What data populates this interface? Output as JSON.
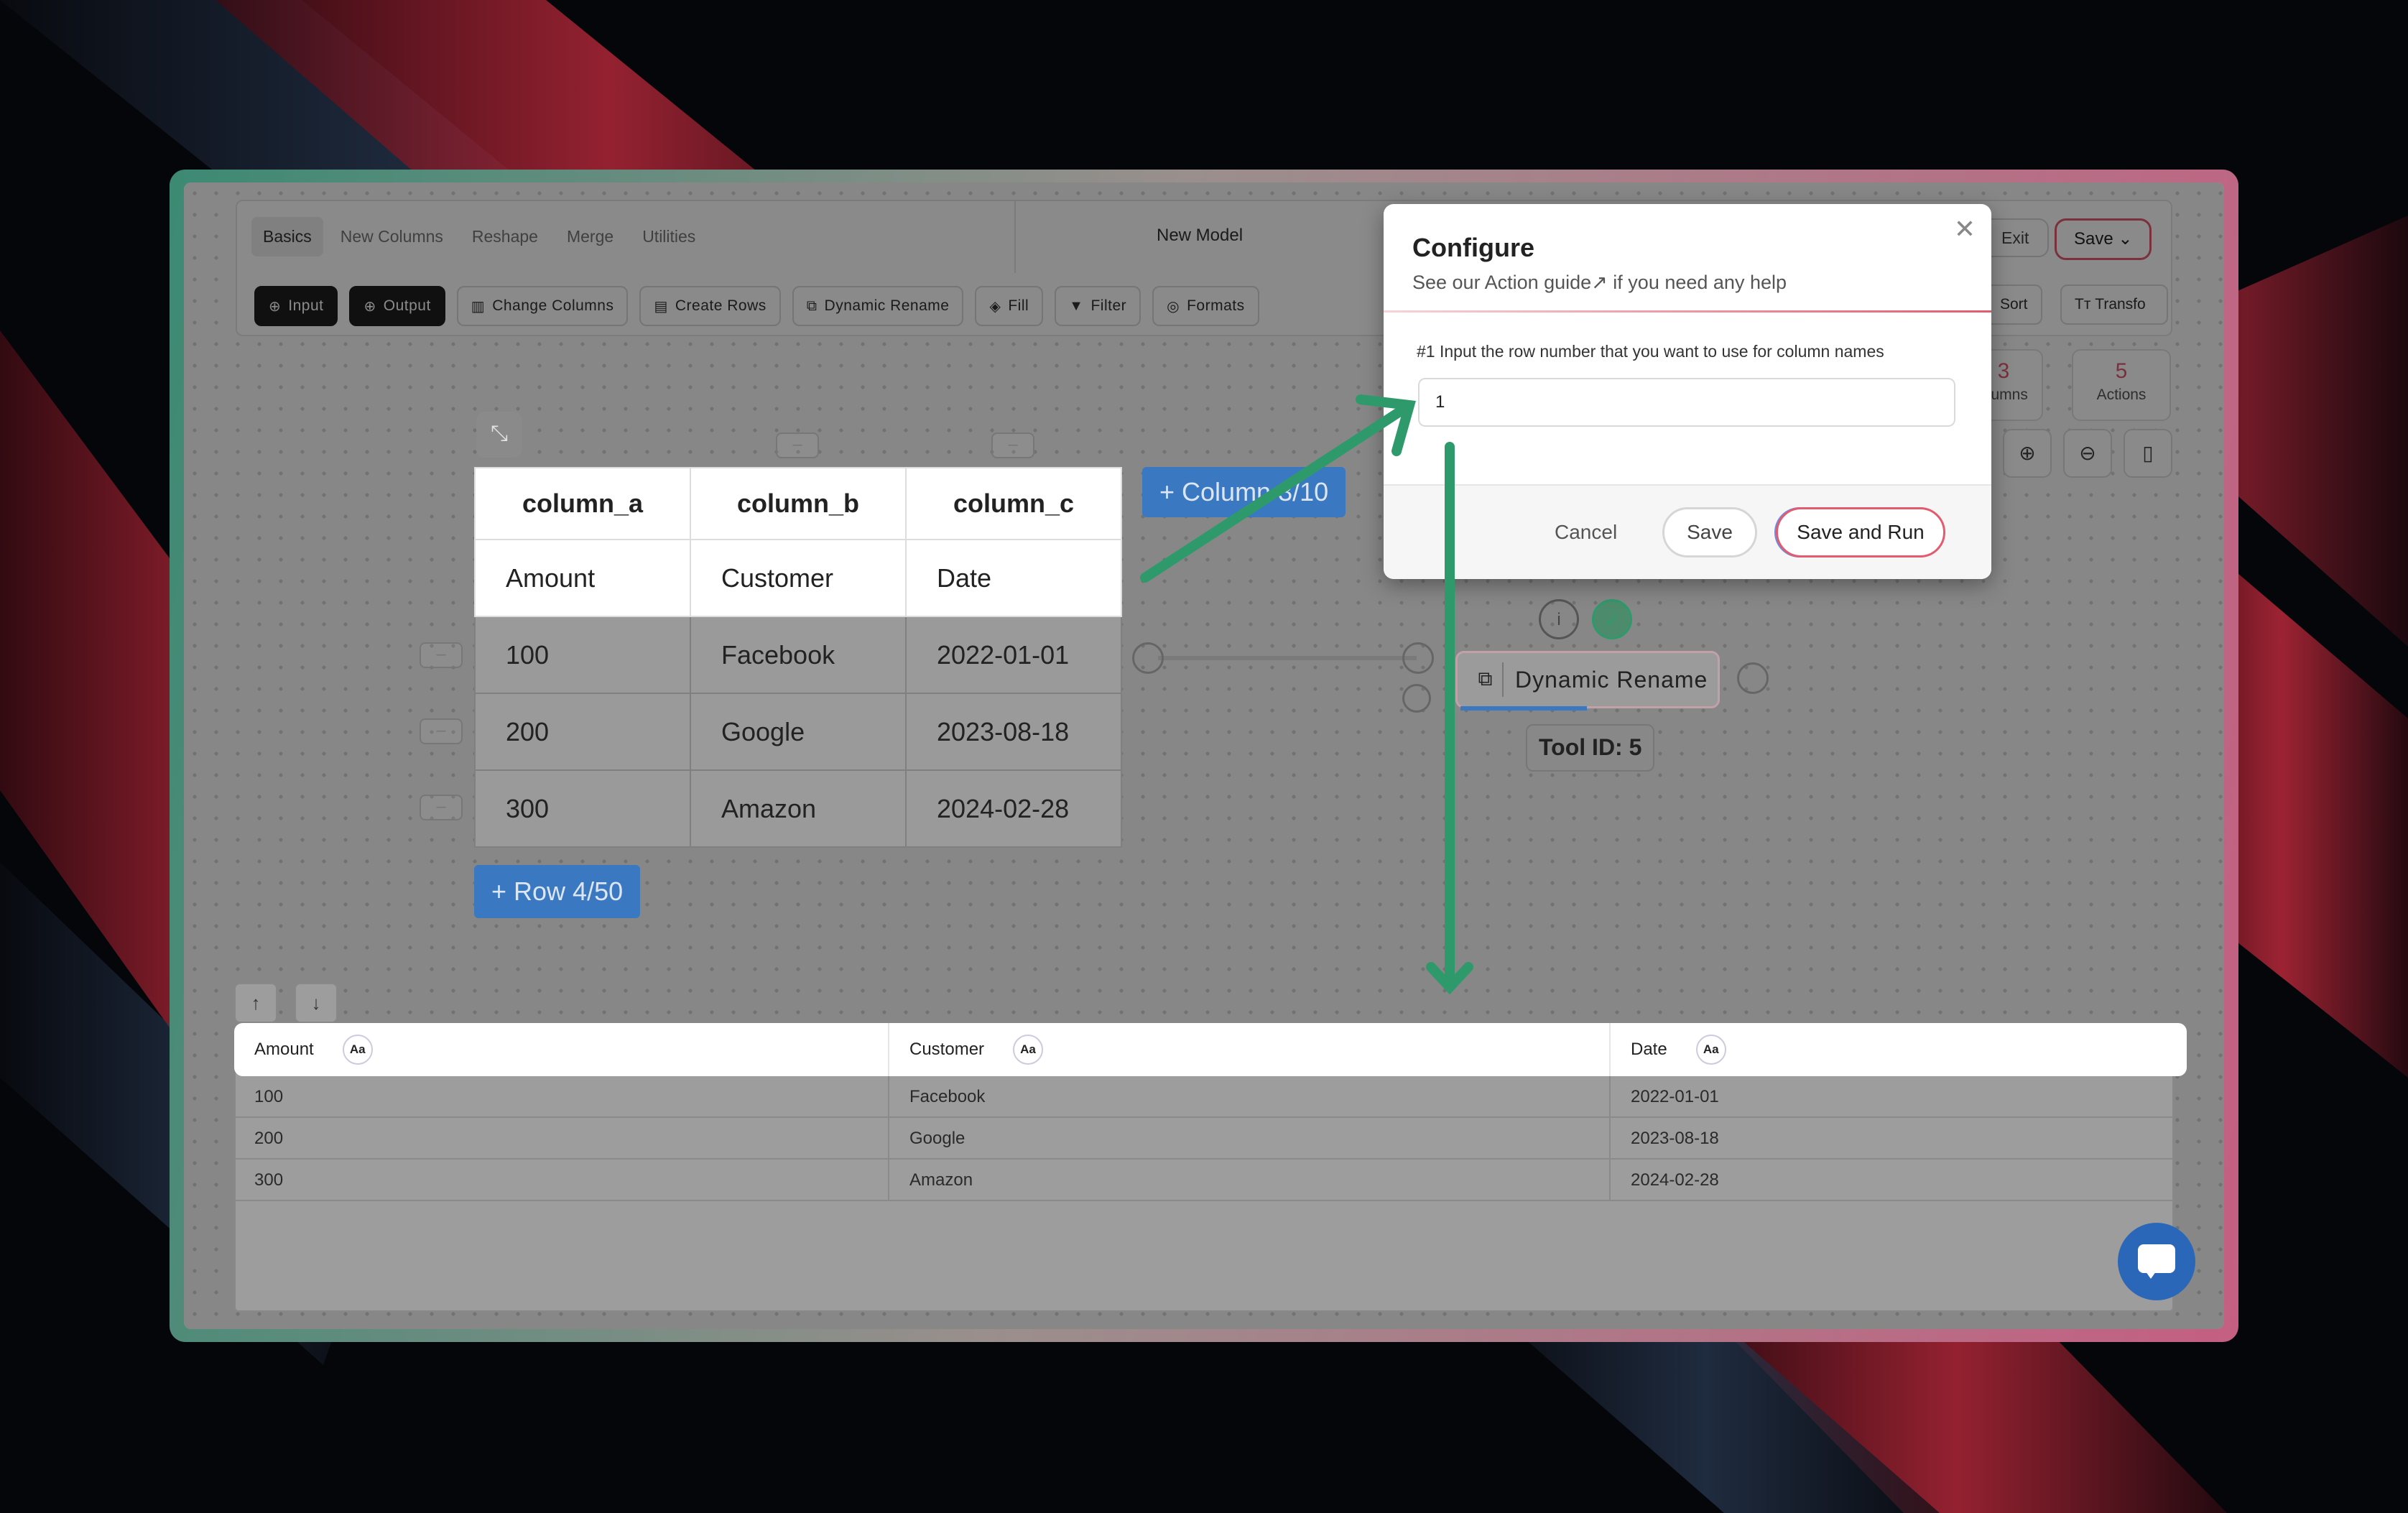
{
  "tabs": [
    "Basics",
    "New Columns",
    "Reshape",
    "Merge",
    "Utilities"
  ],
  "model_name": "New Model",
  "top_buttons": {
    "exit": "Exit",
    "save": "Save"
  },
  "tools": [
    {
      "label": "Input",
      "icon": "plus-circle-icon"
    },
    {
      "label": "Output",
      "icon": "plus-circle-icon"
    },
    {
      "label": "Change Columns",
      "icon": "columns-icon"
    },
    {
      "label": "Create Rows",
      "icon": "rows-icon"
    },
    {
      "label": "Dynamic Rename",
      "icon": "rename-icon"
    },
    {
      "label": "Fill",
      "icon": "paint-bucket-icon"
    },
    {
      "label": "Filter",
      "icon": "filter-icon"
    },
    {
      "label": "Formats",
      "icon": "fingerprint-icon"
    }
  ],
  "right_tools": {
    "sort": "Sort",
    "transform": "Transfo"
  },
  "stats": [
    {
      "value": "3",
      "label": "olumns"
    },
    {
      "value": "5",
      "label": "Actions"
    }
  ],
  "input_table": {
    "headers": [
      "column_a",
      "column_b",
      "column_c"
    ],
    "rows": [
      [
        "Amount",
        "Customer",
        "Date"
      ],
      [
        "100",
        "Facebook",
        "2022-01-01"
      ],
      [
        "200",
        "Google",
        "2023-08-18"
      ],
      [
        "300",
        "Amazon",
        "2024-02-28"
      ]
    ]
  },
  "add_row": "+ Row 4/50",
  "add_column": "+ Column 3/10",
  "node": {
    "label": "Dynamic Rename",
    "tool_id": "Tool ID: 5"
  },
  "output_table": {
    "headers": [
      "Amount",
      "Customer",
      "Date"
    ],
    "type_badge": "Aa",
    "rows": [
      [
        "100",
        "Facebook",
        "2022-01-01"
      ],
      [
        "200",
        "Google",
        "2023-08-18"
      ],
      [
        "300",
        "Amazon",
        "2024-02-28"
      ]
    ]
  },
  "modal": {
    "title": "Configure",
    "subtitle": "See our Action guide↗ if you need any help",
    "question": "#1 Input the row number that you want to use for column names",
    "input_value": "1",
    "cancel": "Cancel",
    "save": "Save",
    "save_and_run": "Save and Run"
  },
  "colors": {
    "accent_green": "#2e9a6c",
    "accent_red": "#e25b6e",
    "accent_blue": "#3a78c2"
  }
}
